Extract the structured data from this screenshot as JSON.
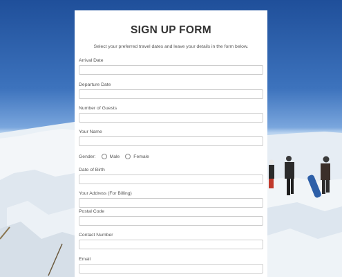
{
  "form": {
    "title": "SIGN UP FORM",
    "description": "Select your preferred travel dates and leave your details in the form below.",
    "fields": {
      "arrival_date": {
        "label": "Arrival Date",
        "value": ""
      },
      "departure_date": {
        "label": "Departure Date",
        "value": ""
      },
      "number_of_guests": {
        "label": "Number of Guests",
        "value": ""
      },
      "your_name": {
        "label": "Your Name",
        "value": ""
      },
      "date_of_birth": {
        "label": "Date of Birth",
        "value": ""
      },
      "address": {
        "label": "Your Address (For Billing)",
        "value": ""
      },
      "postal_code": {
        "label": "Postal Code",
        "value": ""
      },
      "contact_number": {
        "label": "Contact Number",
        "value": ""
      },
      "email": {
        "label": "Email",
        "value": ""
      }
    },
    "gender": {
      "label": "Gender:",
      "options": [
        "Male",
        "Female"
      ]
    }
  },
  "colors": {
    "sky": "#3d73bd",
    "card": "#ffffff",
    "input_border": "#cccccc",
    "text": "#555555",
    "title": "#333333"
  }
}
